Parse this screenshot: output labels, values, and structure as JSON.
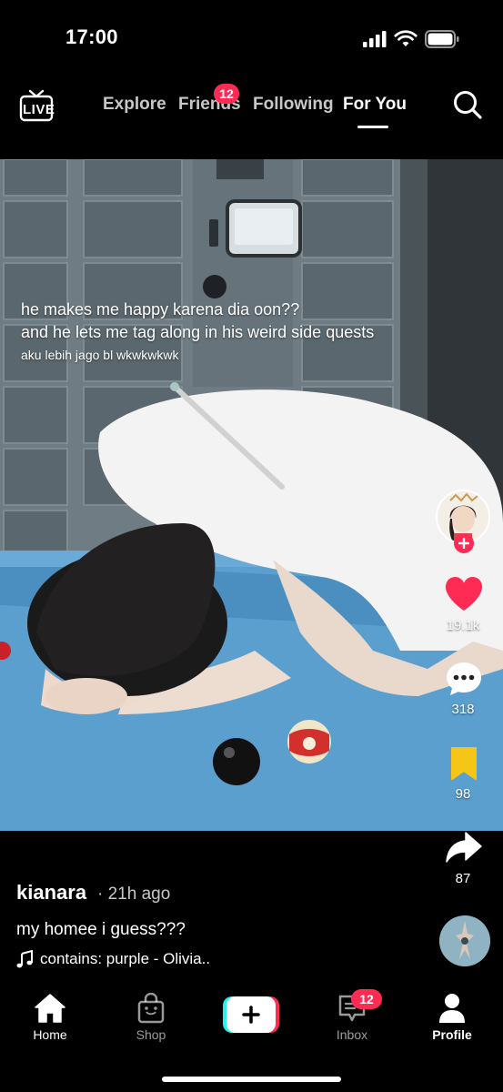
{
  "status_bar": {
    "time": "17:00"
  },
  "top_nav": {
    "live_label": "LIVE",
    "tabs": [
      {
        "label": "Explore"
      },
      {
        "label": "Friends",
        "badge": "12"
      },
      {
        "label": "Following"
      },
      {
        "label": "For You",
        "active": true
      }
    ]
  },
  "video": {
    "caption": [
      "he makes me happy karena dia oon??",
      "and he lets me tag along in his weird side quests",
      "aku lebih jago bl wkwkwkwk"
    ]
  },
  "actions": {
    "likes": "19.1k",
    "comments": "318",
    "saves": "98",
    "shares": "87"
  },
  "post": {
    "username": "kianara",
    "time": "· 21h ago",
    "description": "my homee i guess???",
    "music": "contains: purple - Olivia.."
  },
  "bottom_nav": {
    "items": [
      {
        "label": "Home",
        "active": true
      },
      {
        "label": "Shop"
      },
      {
        "label": "Inbox",
        "badge": "12"
      },
      {
        "label": "Profile"
      }
    ]
  },
  "colors": {
    "accent": "#fe2c55",
    "save": "#f5c518",
    "background": "#000000"
  }
}
